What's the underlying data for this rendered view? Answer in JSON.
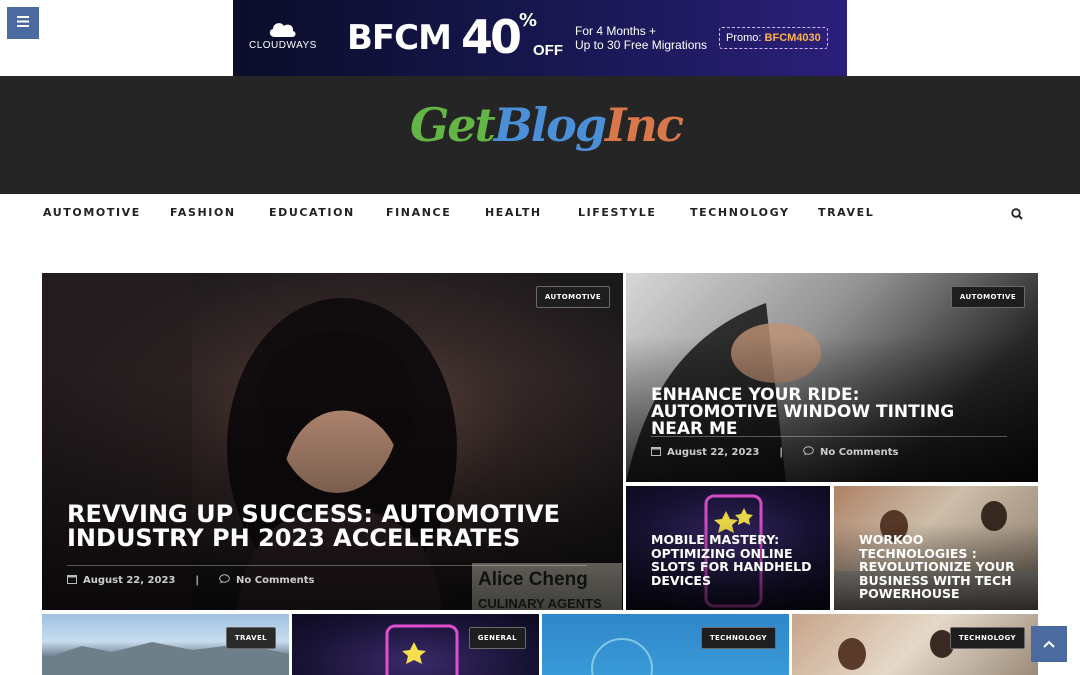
{
  "ad": {
    "brand": "CLOUDWAYS",
    "sale": "BFCM",
    "discount": "40",
    "percent": "%",
    "off": "OFF",
    "offer_line1": "For 4 Months +",
    "offer_line2": "Up to 30 Free Migrations",
    "promo_label": "Promo:",
    "promo_code": "BFCM4030"
  },
  "logo": {
    "part1": "Get",
    "part2": "Blog",
    "part3": "Inc"
  },
  "nav": {
    "items": [
      "AUTOMOTIVE",
      "FASHION",
      "EDUCATION",
      "FINANCE",
      "HEALTH",
      "LIFESTYLE",
      "TECHNOLOGY",
      "TRAVEL"
    ]
  },
  "posts": [
    {
      "category": "AUTOMOTIVE",
      "title": "REVVING UP SUCCESS: AUTOMOTIVE INDUSTRY PH 2023 ACCELERATES",
      "date": "August 22, 2023",
      "comments": "No Comments",
      "caption": "Alice Cheng",
      "caption2": "CULINARY AGENTS"
    },
    {
      "category": "AUTOMOTIVE",
      "title": "ENHANCE YOUR RIDE: AUTOMOTIVE WINDOW TINTING NEAR ME",
      "date": "August 22, 2023",
      "comments": "No Comments"
    },
    {
      "title": "MOBILE MASTERY: OPTIMIZING ONLINE SLOTS FOR HANDHELD DEVICES"
    },
    {
      "title": "WORKOO TECHNOLOGIES : REVOLUTIONIZE YOUR BUSINESS WITH TECH POWERHOUSE"
    },
    {
      "category": "TRAVEL"
    },
    {
      "category": "GENERAL"
    },
    {
      "category": "TECHNOLOGY"
    },
    {
      "category": "TECHNOLOGY"
    }
  ],
  "colors": {
    "accent": "#4b6aa0",
    "header_bg": "#252525"
  },
  "icons": {
    "menu": "hamburger-icon",
    "search": "search-icon",
    "calendar": "calendar-icon",
    "comment": "comment-icon",
    "to_top": "chevron-up-icon"
  }
}
